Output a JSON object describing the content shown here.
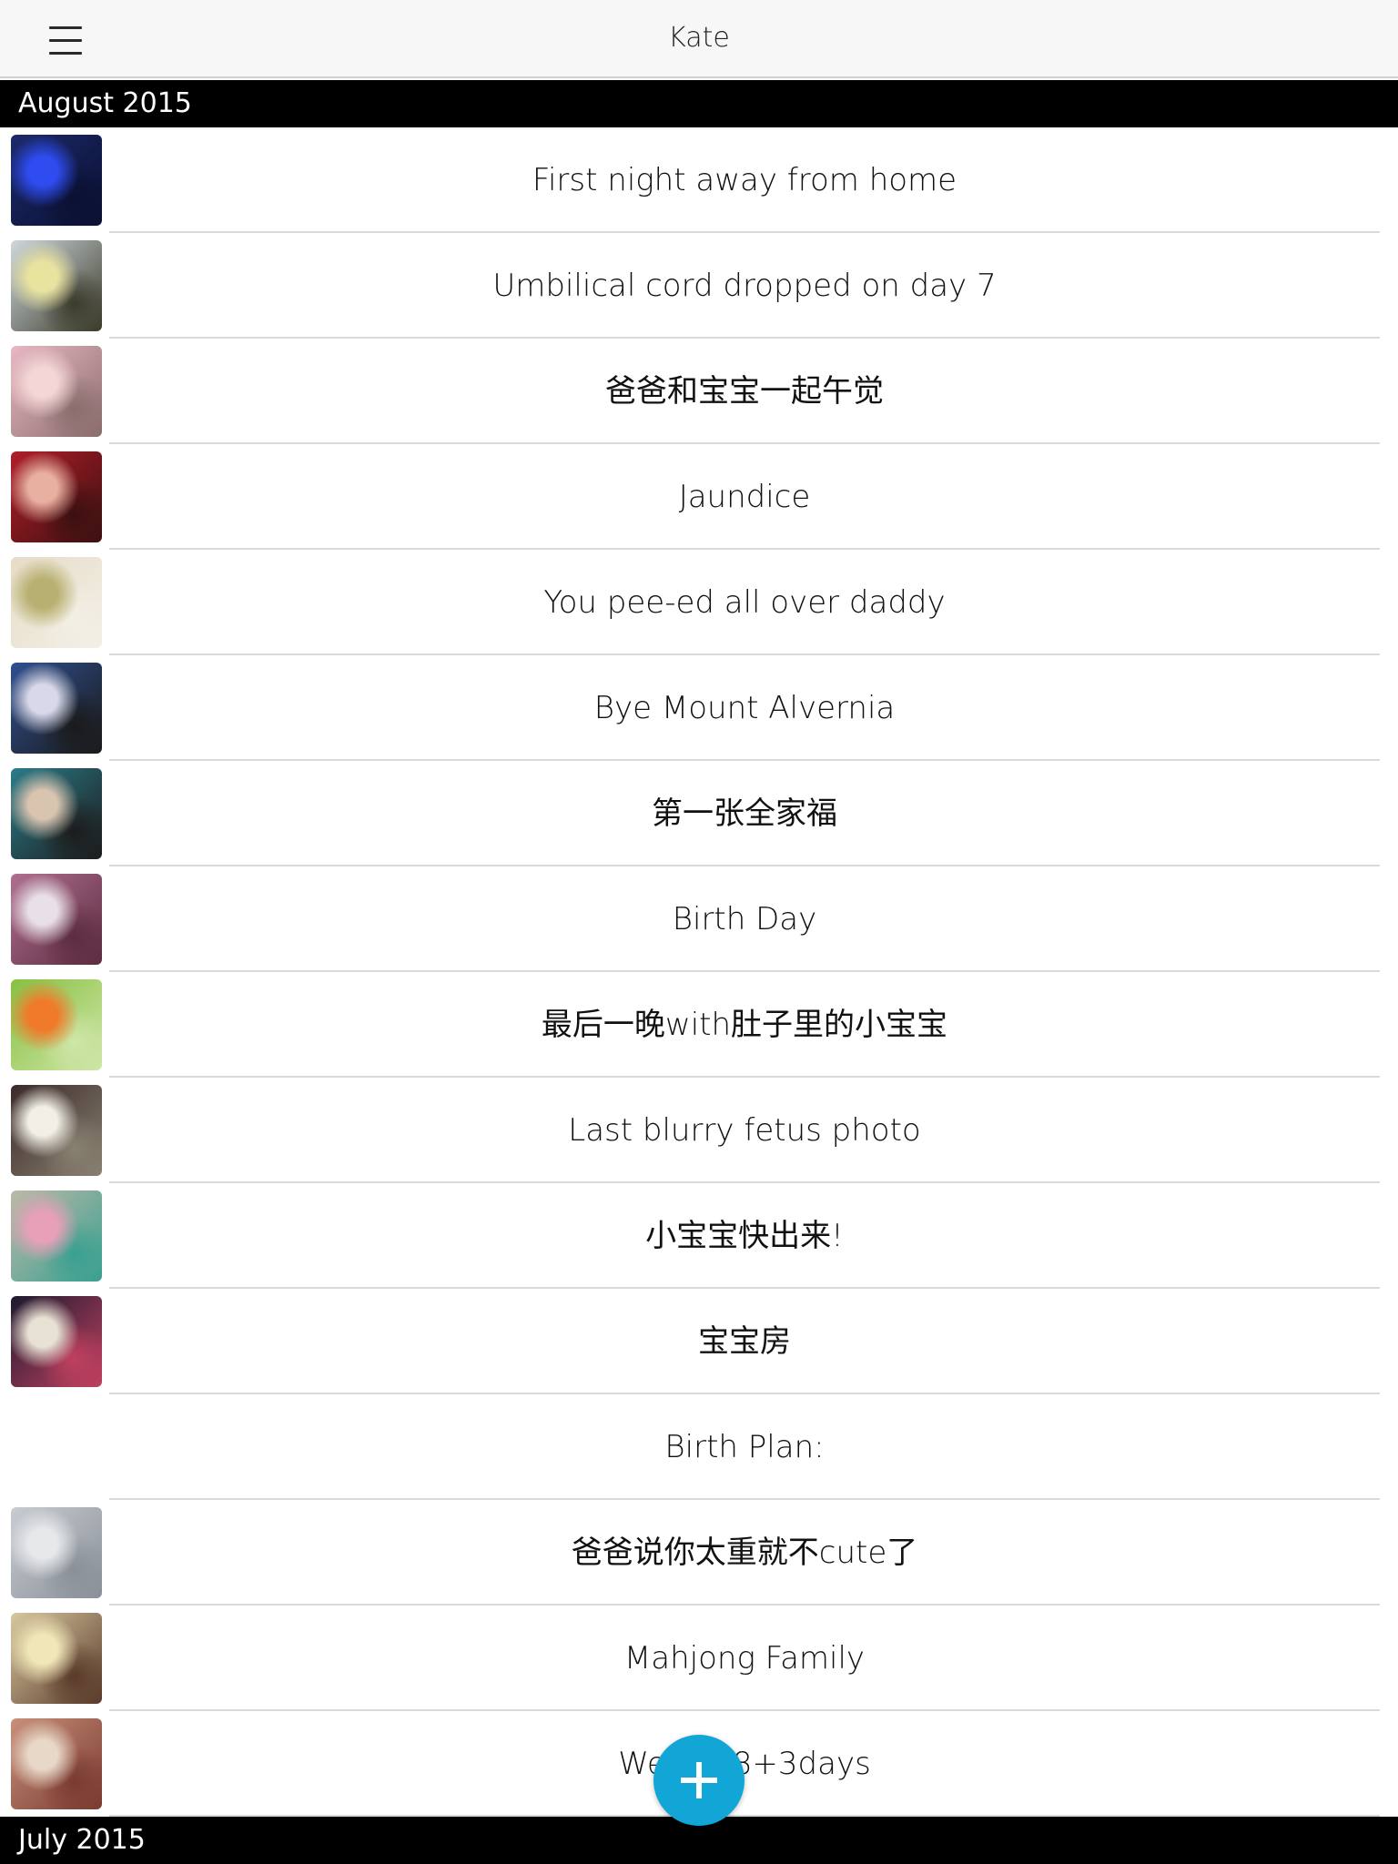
{
  "nav": {
    "title": "Kate"
  },
  "sections": {
    "august": "August 2015",
    "july": "July 2015"
  },
  "entries": [
    {
      "title": "First night away from home",
      "thumb": [
        "#1c2a6b",
        "#2e4cf0",
        "#0a1030"
      ]
    },
    {
      "title": "Umbilical cord dropped on day 7",
      "thumb": [
        "#cfd8de",
        "#e9e3a0",
        "#3b3b2a"
      ]
    },
    {
      "title": "爸爸和宝宝一起午觉",
      "thumb": [
        "#e8b8c4",
        "#f4d6d6",
        "#8a6d6d"
      ]
    },
    {
      "title": "Jaundice",
      "thumb": [
        "#b01e2a",
        "#e8b0a0",
        "#3c1010"
      ]
    },
    {
      "title": "You pee-ed all over daddy",
      "thumb": [
        "#e6ddc8",
        "#b8b070",
        "#f3efe6"
      ]
    },
    {
      "title": "Bye Mount Alvernia",
      "thumb": [
        "#2f4f8f",
        "#d8d8e8",
        "#1a1a1a"
      ]
    },
    {
      "title": "第一张全家福",
      "thumb": [
        "#2c7c8a",
        "#d9c4b0",
        "#1c1c1c"
      ]
    },
    {
      "title": "Birth Day",
      "thumb": [
        "#b07090",
        "#e8e0e6",
        "#5c2c40"
      ]
    },
    {
      "title": "最后一晚with肚子里的小宝宝",
      "thumb": [
        "#86c040",
        "#f07a2a",
        "#cfe6a8"
      ]
    },
    {
      "title": "Last blurry fetus photo",
      "thumb": [
        "#3a2a2a",
        "#f2efe6",
        "#888070"
      ]
    },
    {
      "title": "小宝宝快出来!",
      "thumb": [
        "#bdb8a8",
        "#e7a0b8",
        "#3aa090"
      ]
    },
    {
      "title": "宝宝房",
      "thumb": [
        "#1b1a2e",
        "#e8e2d4",
        "#c04060"
      ]
    },
    {
      "title": "Birth Plan:",
      "thumb": null
    },
    {
      "title": "爸爸说你太重就不cute了",
      "thumb": [
        "#c8ccd2",
        "#e6e8ea",
        "#8a9098"
      ]
    },
    {
      "title": "Mahjong Family",
      "thumb": [
        "#d8c8a0",
        "#f0e6b8",
        "#5a3a2a"
      ]
    },
    {
      "title": "Week 38+3days",
      "thumb": [
        "#c8907a",
        "#e8d8c8",
        "#7a3a30"
      ]
    }
  ]
}
